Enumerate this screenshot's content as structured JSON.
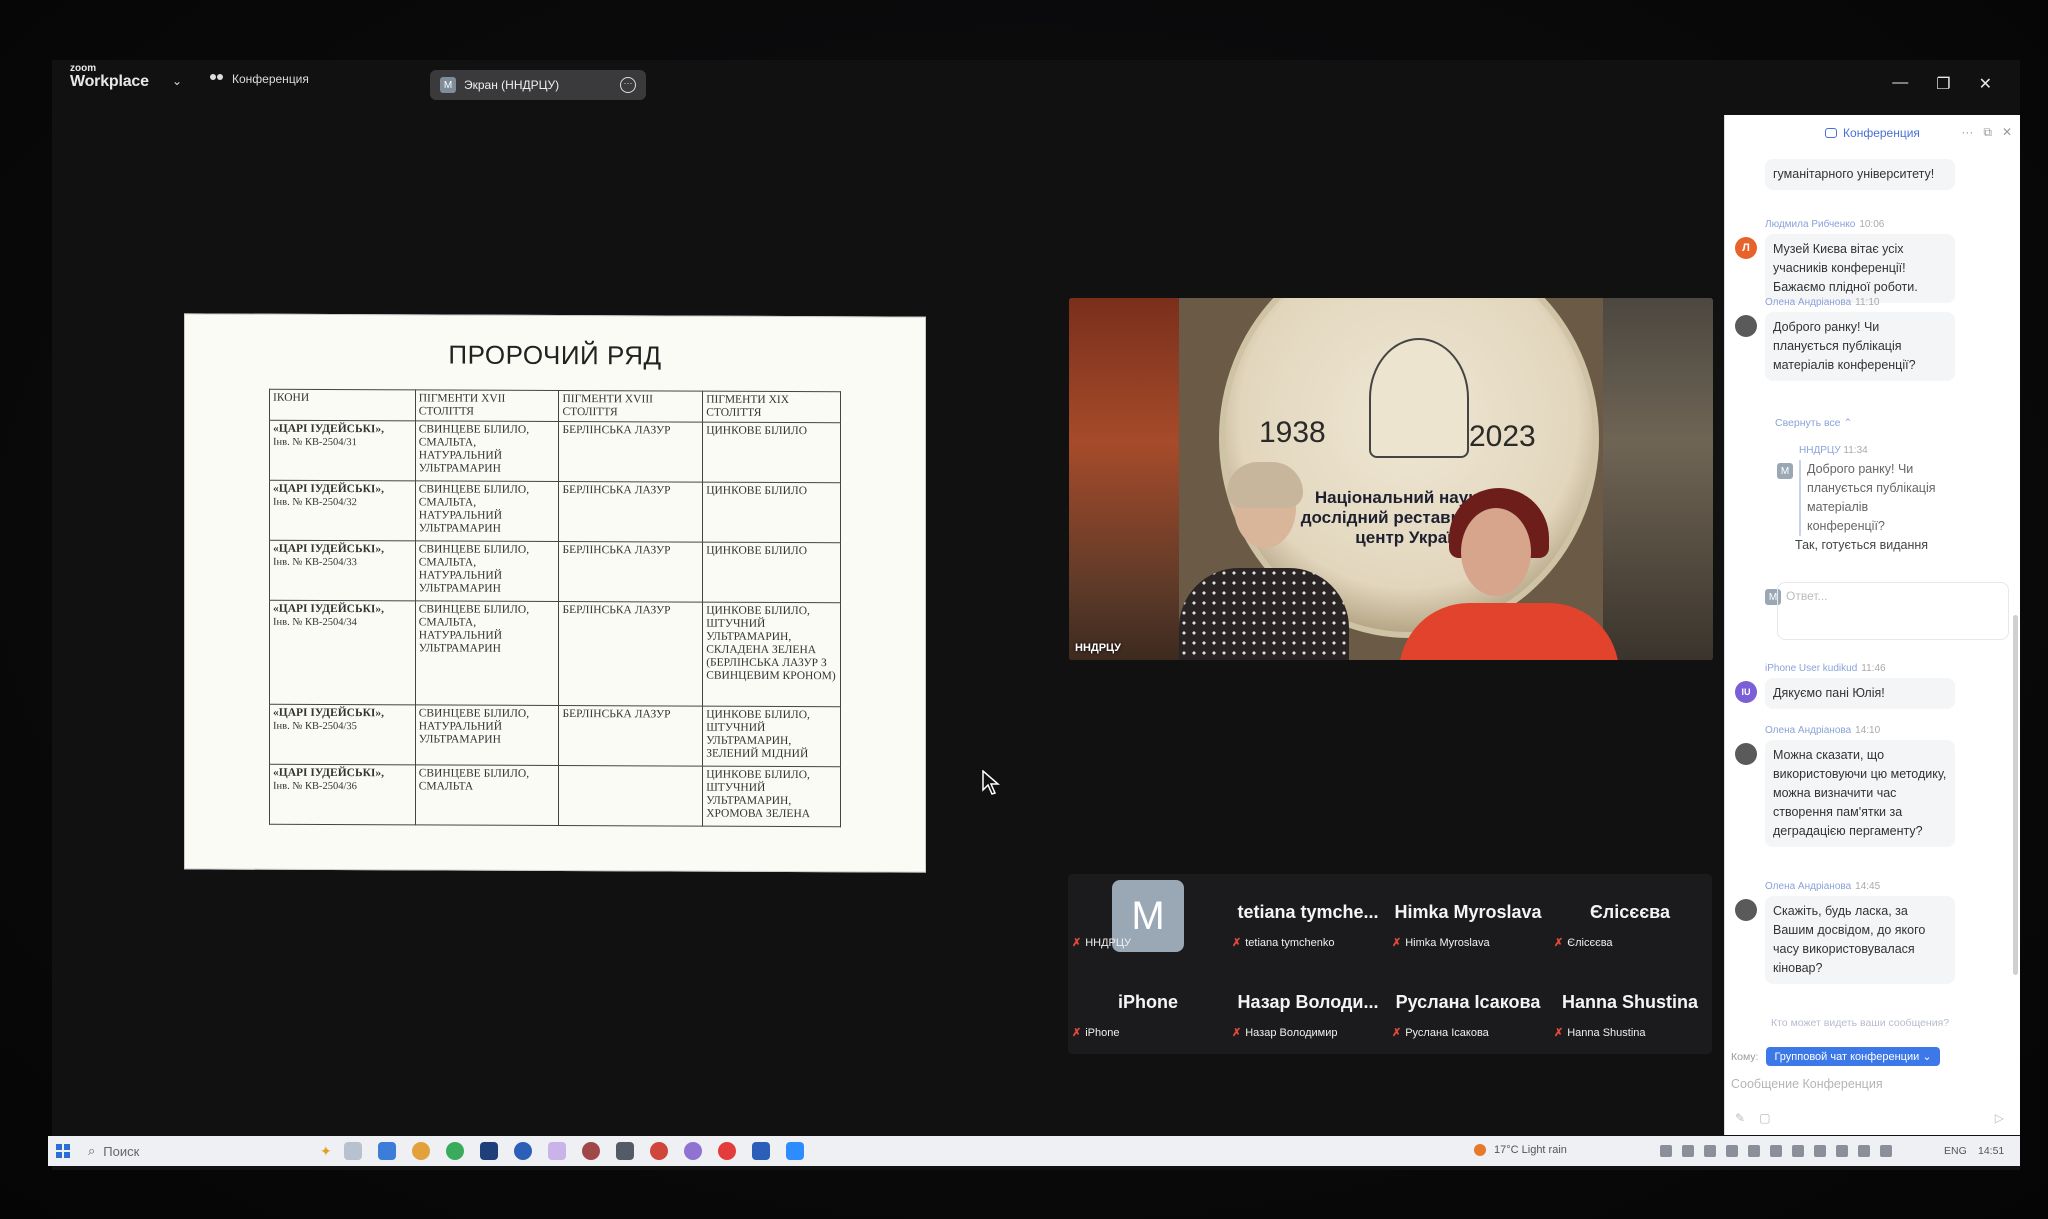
{
  "zoom": {
    "logo_small": "zoom",
    "logo_big": "Workplace",
    "conference_label": "Конференция",
    "screen_pill_avatar": "M",
    "screen_pill_label": "Экран (ННДРЦУ)"
  },
  "slide": {
    "title": "ПРОРОЧИЙ РЯД",
    "headers": [
      "ІКОНИ",
      "ПІГМЕНТИ XVII СТОЛІТТЯ",
      "ПІГМЕНТИ XVIII СТОЛІТТЯ",
      "ПІГМЕНТИ XIX СТОЛІТТЯ"
    ],
    "rows": [
      {
        "icon": "«ЦАРІ ІУДЕЙСЬКІ»,",
        "inv": "Інв. № КВ-2504/31",
        "c17": "СВИНЦЕВЕ БІЛИЛО, СМАЛЬТА, НАТУРАЛЬНИЙ УЛЬТРАМАРИН",
        "c18": "БЕРЛІНСЬКА ЛАЗУР",
        "c19": "ЦИНКОВЕ БІЛИЛО"
      },
      {
        "icon": "«ЦАРІ ІУДЕЙСЬКІ»,",
        "inv": "Інв. № КВ-2504/32",
        "c17": "СВИНЦЕВЕ БІЛИЛО, СМАЛЬТА, НАТУРАЛЬНИЙ УЛЬТРАМАРИН",
        "c18": "БЕРЛІНСЬКА ЛАЗУР",
        "c19": "ЦИНКОВЕ БІЛИЛО"
      },
      {
        "icon": "«ЦАРІ ІУДЕЙСЬКІ»,",
        "inv": "Інв. № КВ-2504/33",
        "c17": "СВИНЦЕВЕ БІЛИЛО, СМАЛЬТА, НАТУРАЛЬНИЙ УЛЬТРАМАРИН",
        "c18": "БЕРЛІНСЬКА ЛАЗУР",
        "c19": "ЦИНКОВЕ БІЛИЛО"
      },
      {
        "icon": "«ЦАРІ ІУДЕЙСЬКІ»,",
        "inv": "Інв. № КВ-2504/34",
        "c17": "СВИНЦЕВЕ БІЛИЛО, СМАЛЬТА, НАТУРАЛЬНИЙ УЛЬТРАМАРИН",
        "c18": "БЕРЛІНСЬКА ЛАЗУР",
        "c19": "ЦИНКОВЕ БІЛИЛО, ШТУЧНИЙ УЛЬТРАМАРИН, СКЛАДЕНА ЗЕЛЕНА (БЕРЛІНСЬКА ЛАЗУР З СВИНЦЕВИМ КРОНОМ)"
      },
      {
        "icon": "«ЦАРІ ІУДЕЙСЬКІ»,",
        "inv": "Інв. № КВ-2504/35",
        "c17": "СВИНЦЕВЕ БІЛИЛО, НАТУРАЛЬНИЙ УЛЬТРАМАРИН",
        "c18": "БЕРЛІНСЬКА ЛАЗУР",
        "c19": "ЦИНКОВЕ БІЛИЛО, ШТУЧНИЙ УЛЬТРАМАРИН, ЗЕЛЕНИЙ МІДНИЙ"
      },
      {
        "icon": "«ЦАРІ ІУДЕЙСЬКІ»,",
        "inv": "Інв. № КВ-2504/36",
        "c17": "СВИНЦЕВЕ БІЛИЛО, СМАЛЬТА",
        "c18": "",
        "c19": "ЦИНКОВЕ БІЛИЛО, ШТУЧНИЙ УЛЬТРАМАРИН, ХРОМОВА ЗЕЛЕНА"
      }
    ]
  },
  "speaker": {
    "name_tag": "ННДРЦУ",
    "year_left": "1938",
    "year_right": "2023",
    "institution": "Національний науково-дослідний реставраційний центр України",
    "emblem_label": "ННДРЦУ"
  },
  "participants": [
    {
      "display": "M",
      "label": "ННДРЦУ",
      "is_avatar": true
    },
    {
      "display": "tetiana  tymche...",
      "label": "tetiana tymchenko"
    },
    {
      "display": "Himka Myroslava",
      "label": "Himka Myroslava"
    },
    {
      "display": "Єлісєєва",
      "label": "Єлісєєва"
    },
    {
      "display": "iPhone",
      "label": "iPhone"
    },
    {
      "display": "Назар  Володи...",
      "label": "Назар Володимир"
    },
    {
      "display": "Руслана Ісакова",
      "label": "Руслана Ісакова"
    },
    {
      "display": "Hanna Shustina",
      "label": "Hanna Shustina"
    }
  ],
  "chat": {
    "title": "Конференция",
    "top_partial": "гуманітарного університету!",
    "messages": [
      {
        "sender": "Людмила Рибченко",
        "time": "10:06",
        "avatar": "Л",
        "color": "#e8632b",
        "text": "Музей Києва вітає усіх учасників конференції! Бажаємо плідної роботи."
      },
      {
        "sender": "Олена Андріанова",
        "time": "11:10",
        "avatar": "",
        "color": "#5a5a5a",
        "text": "Доброго ранку! Чи планується публікація матеріалів конференції?"
      }
    ],
    "collapse_all": "Свернуть все",
    "reply": {
      "sender": "ННДРЦУ",
      "time": "11:34",
      "avatar": "M",
      "quote": "Доброго ранку! Чи планується публікація матеріалів конференції?",
      "answer": "Так, готується видання"
    },
    "reply_placeholder": "Ответ...",
    "messages2": [
      {
        "sender": "iPhone User kudikud",
        "time": "11:46",
        "avatar": "IU",
        "color": "#7b5fd6",
        "text": "Дякуємо пані Юлія!"
      },
      {
        "sender": "Олена Андріанова",
        "time": "14:10",
        "avatar": "",
        "color": "#5a5a5a",
        "text": "Можна сказати, що використовуючи цю методику, можна визначити час створення пам'ятки за деградацією пергаменту?"
      },
      {
        "sender": "Олена Андріанова",
        "time": "14:45",
        "avatar": "",
        "color": "#5a5a5a",
        "text": "Скажіть, будь ласка, за Вашим досвідом, до якого часу використовувалася кіновар?"
      }
    ],
    "who_can_see": "Кто может видеть ваши сообщения?",
    "to_label": "Кому:",
    "to_value": "Групповой чат конференции",
    "message_placeholder": "Сообщение Конференция"
  },
  "taskbar": {
    "search": "Поиск",
    "weather": "17°C  Light rain",
    "lang": "ENG",
    "time": "14:51"
  }
}
